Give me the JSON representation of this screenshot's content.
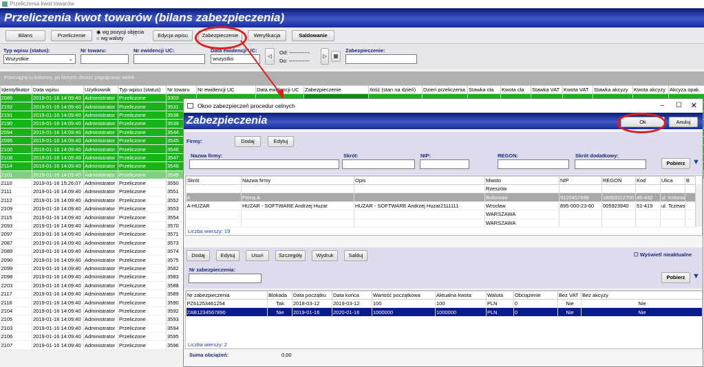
{
  "window": {
    "title": "Przeliczenia kwot towarów",
    "banner": "Przeliczenia kwot towarów (bilans zabezpieczenia)"
  },
  "toolbar": {
    "bilans": "Bilans",
    "przeliczenie": "Przeliczenie",
    "radio1": "wg pozycji objęcia",
    "radio2": "wg waluty",
    "edycja": "Edycja wpisu",
    "zabezpieczenie": "Zabezpieczenie",
    "weryfikacja": "Weryfikacja",
    "saldowanie": "Saldowanie"
  },
  "filters": {
    "typ_label": "Typ wpisu (status):",
    "typ_value": "Wszystkie",
    "nr_towaru_label": "Nr towaru:",
    "nr_ewid_label": "Nr ewidencji UC:",
    "data_label": "Data ewidencji UC:",
    "data_value": "wszystko",
    "od_label": "Od:",
    "od_value": "------------",
    "do_label": "Do:",
    "do_value": "------------",
    "zab_label": "Zabezpieczenie:"
  },
  "groupbar": "Przeciągnij tu kolumny, po których chcesz pogrupować widok",
  "main_columns": [
    "Identyfikator",
    "Data wpisu",
    "Użytkownik",
    "Typ wpisu (status)",
    "Nr towaru",
    "Nr ewidencji UC",
    "Data ewidencji UC",
    "Zabezpieczenie",
    "Ilość (stan na dzień)",
    "Dzień przeliczenia",
    "Stawka cła",
    "Kwota cła",
    "Stawka VAT",
    "Kwota VAT",
    "Stawka akcyzy",
    "Kwota akcyzy",
    "Akcyza opak."
  ],
  "main_rows": [
    [
      "2086",
      "2019-01-16 14:09:40",
      "Administrator",
      "Przeliczone",
      "3303"
    ],
    [
      "2192",
      "2019-01-16 14:09:40",
      "Administrator",
      "Przeliczone",
      "3531"
    ],
    [
      "2191",
      "2019-01-16 14:09:40",
      "Administrator",
      "Przeliczone",
      "3538"
    ],
    [
      "2190",
      "2019-01-16 14:09:40",
      "Administrator",
      "Przeliczone",
      "3539"
    ],
    [
      "2094",
      "2019-01-16 14:09:40",
      "Administrator",
      "Przeliczone",
      "3544"
    ],
    [
      "2095",
      "2019-01-16 14:09:40",
      "Administrator",
      "Przeliczone",
      "3545"
    ],
    [
      "2100",
      "2019-01-16 14:09:40",
      "Administrator",
      "Przeliczone",
      "3546"
    ],
    [
      "2108",
      "2019-01-16 14:09:40",
      "Administrator",
      "Przeliczone",
      "3547"
    ],
    [
      "2114",
      "2019-01-16 14:09:40",
      "Administrator",
      "Przeliczone",
      "3548"
    ],
    [
      "2101",
      "2019-01-16 14:09:40",
      "Administrator",
      "Przeliczone",
      "3549"
    ],
    [
      "2110",
      "2019-01-16 15:26:07",
      "Administrator",
      "Przeliczone",
      "3550"
    ],
    [
      "2111",
      "2019-01-16 14:09:40",
      "Administrator",
      "Przeliczone",
      "3551"
    ],
    [
      "2112",
      "2019-01-16 14:09:40",
      "Administrator",
      "Przeliczone",
      "3552"
    ],
    [
      "2109",
      "2019-01-16 14:09:40",
      "Administrator",
      "Przeliczone",
      "3553"
    ],
    [
      "2115",
      "2019-01-16 14:09:40",
      "Administrator",
      "Przeliczone",
      "3554"
    ],
    [
      "2093",
      "2019-01-16 14:09:40",
      "Administrator",
      "Przeliczone",
      "3570"
    ],
    [
      "2097",
      "2019-01-16 14:09:40",
      "Administrator",
      "Przeliczone",
      "3571"
    ],
    [
      "2087",
      "2019-01-16 14:09:40",
      "Administrator",
      "Przeliczone",
      "3573"
    ],
    [
      "2089",
      "2019-01-16 14:09:40",
      "Administrator",
      "Przeliczone",
      "3574"
    ],
    [
      "2090",
      "2019-01-16 14:09:40",
      "Administrator",
      "Przeliczone",
      "3575"
    ],
    [
      "2099",
      "2019-01-16 14:09:40",
      "Administrator",
      "Przeliczone",
      "3582"
    ],
    [
      "2098",
      "2019-01-16 14:09:40",
      "Administrator",
      "Przeliczone",
      "3583"
    ],
    [
      "2203",
      "2019-01-16 14:09:40",
      "Administrator",
      "Przeliczone",
      "3588"
    ],
    [
      "2117",
      "2019-01-16 14:09:40",
      "Administrator",
      "Przeliczone",
      "3589"
    ],
    [
      "2116",
      "2019-01-16 14:09:40",
      "Administrator",
      "Przeliczone",
      "3590"
    ],
    [
      "2104",
      "2019-01-16 14:09:40",
      "Administrator",
      "Przeliczone",
      "3592"
    ],
    [
      "2105",
      "2019-01-16 14:09:40",
      "Administrator",
      "Przeliczone",
      "3593"
    ],
    [
      "2103",
      "2019-01-16 14:09:40",
      "Administrator",
      "Przeliczone",
      "3594"
    ],
    [
      "2106",
      "2019-01-16 14:09:40",
      "Administrator",
      "Przeliczone",
      "3595"
    ],
    [
      "2107",
      "2019-01-16 14:09:40",
      "Administrator",
      "Przeliczone",
      "3596"
    ]
  ],
  "dialog": {
    "title": "Okno zabezpieczeń procedur celnych",
    "banner": "Zabezpieczenia",
    "ok": "Ok",
    "cancel": "Anuluj",
    "firmy_label": "Firmy:",
    "dodaj": "Dodaj",
    "edytuj": "Edytuj",
    "nazwa_label": "Nazwa firmy:",
    "skrot_label": "Skrót:",
    "nip_label": "NIP:",
    "regon_label": "REGON:",
    "skrot_dod_label": "Skrót dodatkowy:",
    "pobierz": "Pobierz",
    "firm_columns": [
      "Skrót",
      "Nazwa firmy",
      "Opis",
      "Miasto",
      "NIP",
      "REGON",
      "Kod",
      "Ulica",
      "B"
    ],
    "firm_rows": [
      [
        "",
        "",
        "",
        "Rzeszów",
        "",
        "",
        "",
        ""
      ],
      [
        "A",
        "Firma A",
        "",
        "Buforowo",
        "9120457698",
        "18003112700",
        "45-432",
        "ul. Kolorowa"
      ],
      [
        "A-HUZAR",
        "HUZAR - SOFTWARE Andrzej Huzar",
        "HUZAR - SOFTWARE Andrzej Huzar2111111",
        "Wrocław",
        "895-000-23-60",
        "005923940",
        "51-419",
        "ul. Tczewska 1"
      ],
      [
        "",
        "",
        "",
        "WARSZAWA",
        "",
        "",
        "",
        ""
      ],
      [
        "",
        "",
        "",
        "WARSZAWA",
        "",
        "",
        "",
        ""
      ]
    ],
    "firm_count": "Liczba wierszy: 19",
    "btn2": [
      "Dodaj",
      "Edytuj",
      "Usuń",
      "Szczegóły",
      "Wydruk",
      "Salduj"
    ],
    "wyswietl": "Wyświetl nieaktualne",
    "nr_zab_label": "Nr zabezpieczenia:",
    "zab_columns": [
      "Nr zabezpieczenia",
      "Blokada",
      "Data początku",
      "Data końca",
      "Wartość początkowa",
      "Aktualna kwota",
      "Waluta",
      "Obciążenie",
      "Bez VAT",
      "Bez akcyzy"
    ],
    "zab_rows": [
      [
        "PZ61253461254",
        "Tak",
        "2018-03-12",
        "2019-03-12",
        "100",
        "100",
        "PLN",
        "0",
        "Nie",
        "Nie"
      ],
      [
        "ZAB1234567890",
        "Nie",
        "2019-01-16",
        "2020-01-16",
        "1000000",
        "1000000",
        "PLN",
        "0",
        "Nie",
        "Nie"
      ]
    ],
    "zab_count": "Liczba wierszy: 2",
    "suma_label": "Suma obciążeń:",
    "suma_value": "0,00"
  }
}
